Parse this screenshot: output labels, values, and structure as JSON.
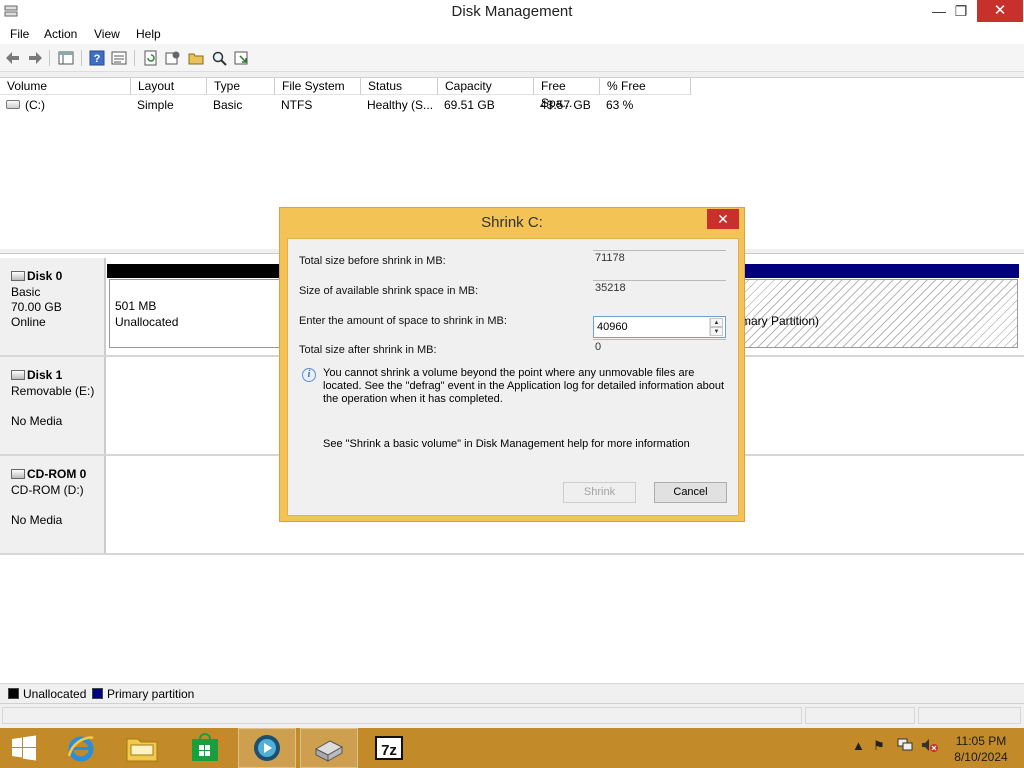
{
  "window": {
    "title": "Disk Management",
    "controls": {
      "minimize": "—",
      "restore": "❐",
      "close": "✕"
    }
  },
  "menu": [
    "File",
    "Action",
    "View",
    "Help"
  ],
  "toolbar": {
    "icons": [
      "back-arrow-icon",
      "forward-arrow-icon",
      "console-tree-icon",
      "help-icon",
      "properties-icon",
      "refresh-icon",
      "settings-icon",
      "open-folder-icon",
      "search-icon",
      "export-icon"
    ]
  },
  "volume_list": {
    "columns": [
      "Volume",
      "Layout",
      "Type",
      "File System",
      "Status",
      "Capacity",
      "Free Spa...",
      "% Free"
    ],
    "rows": [
      {
        "volume": "(C:)",
        "layout": "Simple",
        "type": "Basic",
        "file_system": "NTFS",
        "status": "Healthy (S...",
        "capacity": "69.51 GB",
        "free": "43.57 GB",
        "pct_free": "63 %"
      }
    ]
  },
  "disks": [
    {
      "name": "Disk 0",
      "lines": [
        "Basic",
        "70.00 GB",
        "Online"
      ]
    },
    {
      "name": "Disk 1",
      "lines": [
        "Removable (E:)",
        "",
        "No Media"
      ]
    },
    {
      "name": "CD-ROM 0",
      "lines": [
        "CD-ROM (D:)",
        "",
        "No Media"
      ]
    }
  ],
  "disk0_partitions": {
    "unallocated": {
      "size": "501 MB",
      "label": "Unallocated"
    },
    "primary": {
      "label": "mary Partition)"
    }
  },
  "legend": [
    {
      "label": "Unallocated",
      "color": "#000000"
    },
    {
      "label": "Primary partition",
      "color": "#00007c"
    }
  ],
  "dialog": {
    "title": "Shrink C:",
    "close": "✕",
    "fields": [
      {
        "label": "Total size before shrink in MB:",
        "value": "71178"
      },
      {
        "label": "Size of available shrink space in MB:",
        "value": "35218"
      },
      {
        "label": "Enter the amount of space to shrink in MB:",
        "value": "40960"
      },
      {
        "label": "Total size after shrink in MB:",
        "value": "0"
      }
    ],
    "info": "You cannot shrink a volume beyond the point where any unmovable files are located. See the \"defrag\" event in the Application log for detailed information about the operation when it has completed.",
    "help": "See \"Shrink a basic volume\" in Disk Management help for more information",
    "buttons": {
      "shrink": "Shrink",
      "cancel": "Cancel"
    }
  },
  "taskbar": {
    "apps": [
      "internet-explorer-icon",
      "file-explorer-icon",
      "store-icon",
      "media-icon",
      "disk-management-icon",
      "7zip-icon"
    ],
    "clock": {
      "time": "11:05 PM",
      "date": "8/10/2024"
    }
  },
  "colors": {
    "dialog_frame": "#f3c356",
    "taskbar": "#c28a29",
    "close_red": "#c7302b",
    "primary_blue": "#00007c"
  }
}
